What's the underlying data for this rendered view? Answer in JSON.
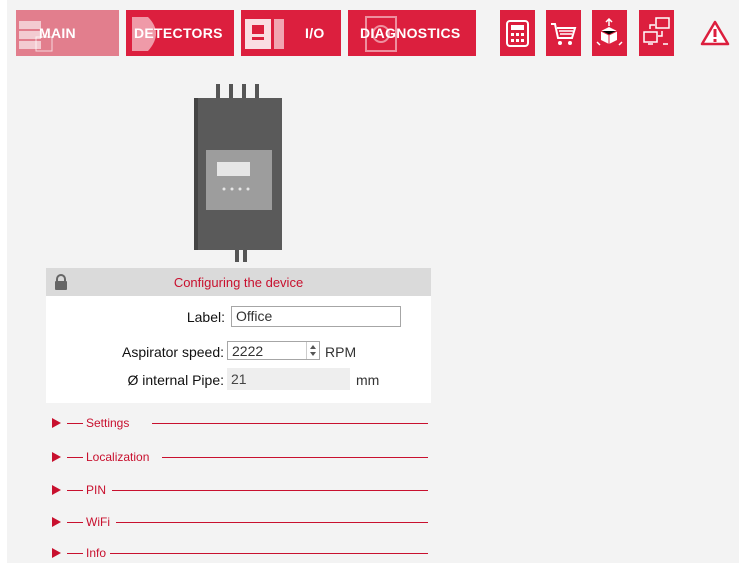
{
  "nav": {
    "tabs": [
      {
        "label": "MAIN",
        "active": true
      },
      {
        "label": "DETECTORS"
      },
      {
        "label": "I/O"
      },
      {
        "label": "DIAGNOSTICS"
      }
    ],
    "icon_buttons": [
      "calculator-icon",
      "cart-icon",
      "package-icon",
      "network-icon"
    ],
    "alert_icon": "warning-icon"
  },
  "panel": {
    "title": "Configuring the device",
    "lock_icon": "lock-icon",
    "fields": {
      "label": {
        "label": "Label:",
        "value": "Office"
      },
      "aspirator": {
        "label": "Aspirator speed:",
        "value": "2222",
        "unit": "RPM"
      },
      "pipe": {
        "label": "Ø internal Pipe:",
        "value": "21",
        "unit": "mm"
      }
    }
  },
  "sections": [
    "Settings",
    "Localization",
    "PIN",
    "WiFi",
    "Info"
  ],
  "colors": {
    "accent": "#dc1f3e",
    "active_tab": "#e27e8d",
    "panel_header": "#dadada",
    "page_bg": "#f3f3f3"
  }
}
